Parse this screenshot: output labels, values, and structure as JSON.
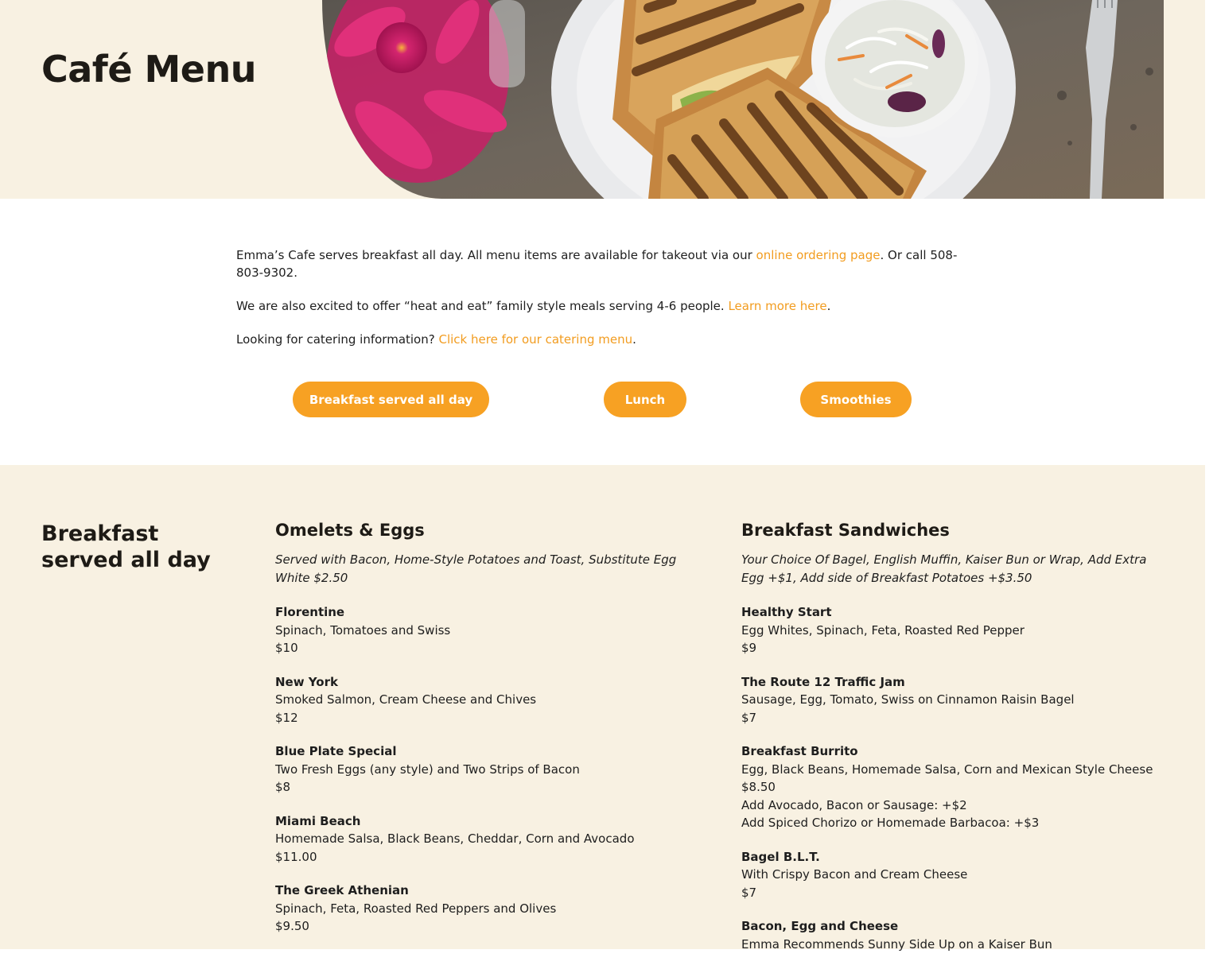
{
  "header": {
    "title": "Café Menu",
    "photo_icon": "grilled-sandwich-photo"
  },
  "intro": {
    "p1_text": "Emma’s Cafe serves breakfast all day. All menu items are available for takeout via our ",
    "p1_link": "online ordering page",
    "p1_after": ". Or call 508-803-9302.",
    "p2_text": "We are also excited to offer “heat and eat” family style meals serving 4-6 people. ",
    "p2_link": "Learn more here",
    "p2_after": ".",
    "p3_text": "Looking for catering information? ",
    "p3_link": "Click here for our catering menu",
    "p3_after": "."
  },
  "nav": {
    "breakfast": "Breakfast served all day",
    "lunch": "Lunch",
    "smoothies": "Smoothies"
  },
  "colors": {
    "accent": "#f7a123",
    "link": "#f29c1f",
    "cream": "#f8f1e2"
  },
  "section": {
    "title": "Breakfast served all day",
    "omelets": {
      "heading": "Omelets & Eggs",
      "note": "Served with Bacon, Home-Style Potatoes and Toast, Substitute Egg White $2.50",
      "items": [
        {
          "name": "Florentine",
          "desc": "Spinach, Tomatoes and Swiss",
          "price": "$10"
        },
        {
          "name": "New York",
          "desc": "Smoked Salmon, Cream Cheese and Chives",
          "price": "$12"
        },
        {
          "name": "Blue Plate Special",
          "desc": "Two Fresh Eggs (any style) and Two Strips of Bacon",
          "price": "$8"
        },
        {
          "name": "Miami Beach",
          "desc": "Homemade Salsa, Black Beans, Cheddar, Corn and Avocado",
          "price": "$11.00"
        },
        {
          "name": "The Greek Athenian",
          "desc": "Spinach, Feta, Roasted Red Peppers and Olives",
          "price": "$9.50"
        }
      ]
    },
    "sandwiches": {
      "heading": "Breakfast Sandwiches",
      "note": "Your Choice Of Bagel, English Muffin, Kaiser Bun or Wrap, Add Extra Egg +$1, Add side of Breakfast Potatoes +$3.50",
      "items": [
        {
          "name": "Healthy Start",
          "desc": "Egg Whites, Spinach, Feta, Roasted Red Pepper",
          "price": "$9"
        },
        {
          "name": "The Route 12 Traffic Jam",
          "desc": "Sausage, Egg, Tomato, Swiss on Cinnamon Raisin Bagel",
          "price": "$7"
        },
        {
          "name": "Breakfast Burrito",
          "desc": "Egg, Black Beans, Homemade Salsa, Corn and Mexican Style Cheese",
          "price": "$8.50",
          "extra1": "Add Avocado, Bacon or Sausage: +$2",
          "extra2": "Add Spiced Chorizo or Homemade Barbacoa: +$3"
        },
        {
          "name": "Bagel B.L.T.",
          "desc": "With Crispy Bacon and Cream Cheese",
          "price": "$7"
        },
        {
          "name": "Bacon, Egg and Cheese",
          "desc": "Emma Recommends Sunny Side Up on a Kaiser Bun"
        }
      ]
    }
  }
}
